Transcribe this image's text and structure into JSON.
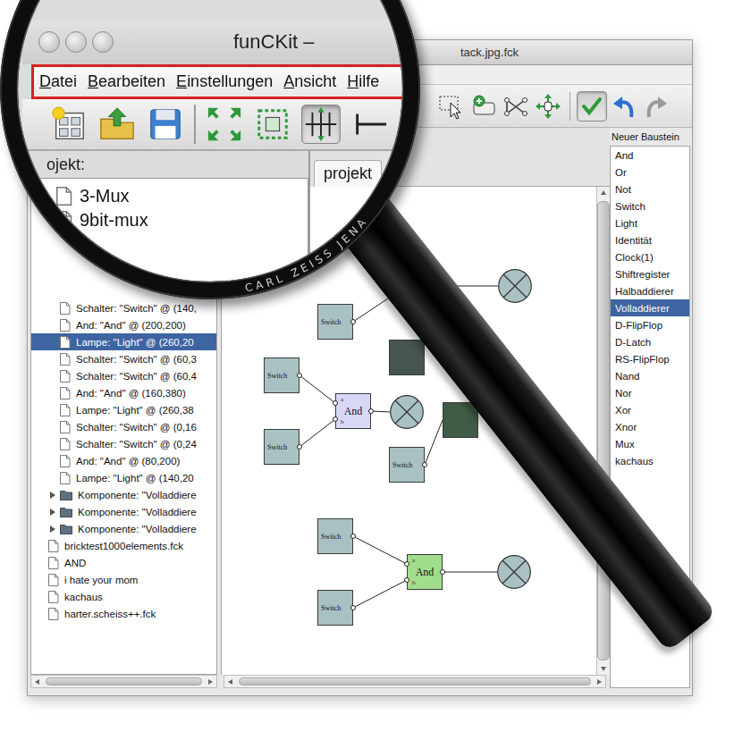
{
  "window": {
    "title": "tack.jpg.fck"
  },
  "toolbar": [
    {
      "kind": "select",
      "selected": false
    },
    {
      "kind": "add",
      "selected": false
    },
    {
      "kind": "connect",
      "selected": false
    },
    {
      "kind": "move",
      "selected": false
    },
    {
      "kind": "separator",
      "selected": false
    },
    {
      "kind": "check",
      "selected": true
    },
    {
      "kind": "undo",
      "selected": false
    },
    {
      "kind": "redo",
      "selected": false
    }
  ],
  "project_tree": {
    "rows": [
      {
        "text": "Schalter: \"Switch\" @ (140,",
        "kind": "file",
        "level": 1,
        "selected": false
      },
      {
        "text": "And: \"And\" @ (200,200)",
        "kind": "file",
        "level": 1,
        "selected": false
      },
      {
        "text": "Lampe: \"Light\" @ (260,20",
        "kind": "file",
        "level": 1,
        "selected": true
      },
      {
        "text": "Schalter: \"Switch\" @ (60,3",
        "kind": "file",
        "level": 1,
        "selected": false
      },
      {
        "text": "Schalter: \"Switch\" @ (60,4",
        "kind": "file",
        "level": 1,
        "selected": false
      },
      {
        "text": "And: \"And\" @ (160,380)",
        "kind": "file",
        "level": 1,
        "selected": false
      },
      {
        "text": "Lampe: \"Light\" @ (260,38",
        "kind": "file",
        "level": 1,
        "selected": false
      },
      {
        "text": "Schalter: \"Switch\" @ (0,16",
        "kind": "file",
        "level": 1,
        "selected": false
      },
      {
        "text": "Schalter: \"Switch\" @ (0,24",
        "kind": "file",
        "level": 1,
        "selected": false
      },
      {
        "text": "And: \"And\" @ (80,200)",
        "kind": "file",
        "level": 1,
        "selected": false
      },
      {
        "text": "Lampe: \"Light\" @ (140,20",
        "kind": "file",
        "level": 1,
        "selected": false
      },
      {
        "text": "Komponente: \"Volladdiere",
        "kind": "folder",
        "level": 1,
        "selected": false,
        "expanded": false
      },
      {
        "text": "Komponente: \"Volladdiere",
        "kind": "folder",
        "level": 1,
        "selected": false,
        "expanded": false
      },
      {
        "text": "Komponente: \"Volladdiere",
        "kind": "folder",
        "level": 1,
        "selected": false,
        "expanded": false
      },
      {
        "text": "bricktest1000elements.fck",
        "kind": "file",
        "level": 0,
        "selected": false
      },
      {
        "text": "AND",
        "kind": "file",
        "level": 0,
        "selected": false
      },
      {
        "text": "i hate your mom",
        "kind": "file",
        "level": 0,
        "selected": false
      },
      {
        "text": "kachaus",
        "kind": "file",
        "level": 0,
        "selected": false
      },
      {
        "text": "harter.scheiss++.fck",
        "kind": "file",
        "level": 0,
        "selected": false
      }
    ]
  },
  "palette": {
    "label": "Neuer Baustein",
    "items": [
      {
        "label": "And",
        "selected": false
      },
      {
        "label": "Or",
        "selected": false
      },
      {
        "label": "Not",
        "selected": false
      },
      {
        "label": "Switch",
        "selected": false
      },
      {
        "label": "Light",
        "selected": false
      },
      {
        "label": "Identität",
        "selected": false
      },
      {
        "label": "Clock(1)",
        "selected": false
      },
      {
        "label": "Shiftregister",
        "selected": false
      },
      {
        "label": "Halbaddierer",
        "selected": false
      },
      {
        "label": "Volladdierer",
        "selected": true
      },
      {
        "label": "D-FlipFlop",
        "selected": false
      },
      {
        "label": "D-Latch",
        "selected": false
      },
      {
        "label": "RS-FlipFlop",
        "selected": false
      },
      {
        "label": "Nand",
        "selected": false
      },
      {
        "label": "Nor",
        "selected": false
      },
      {
        "label": "Xor",
        "selected": false
      },
      {
        "label": "Xnor",
        "selected": false
      },
      {
        "label": "Mux",
        "selected": false
      },
      {
        "label": "kachaus",
        "selected": false
      }
    ]
  },
  "canvas": {
    "components": [
      {
        "kind": "switch",
        "label": "Switch",
        "color": "#a9c1c3"
      },
      {
        "kind": "block",
        "color": "#3d5d4a"
      },
      {
        "kind": "light",
        "color": "#a9c1c3"
      },
      {
        "kind": "switch",
        "label": "Switch",
        "color": "#a9c1c3"
      },
      {
        "kind": "switch",
        "label": "Switch",
        "color": "#a9c1c3"
      },
      {
        "kind": "and",
        "label": "And",
        "ports": [
          "a",
          "b"
        ],
        "color": "#d8d8f6"
      },
      {
        "kind": "light",
        "color": "#a9c1c3"
      },
      {
        "kind": "block",
        "color": "#46554f"
      },
      {
        "kind": "block",
        "color": "#3f5a45"
      },
      {
        "kind": "switch",
        "label": "Switch",
        "color": "#a9c1c3"
      },
      {
        "kind": "switch",
        "label": "Switch",
        "color": "#a9c1c3"
      },
      {
        "kind": "switch",
        "label": "Switch",
        "color": "#a9c1c3"
      },
      {
        "kind": "and",
        "label": "And",
        "ports": [
          "a",
          "b"
        ],
        "color": "#a0dd8c"
      },
      {
        "kind": "light",
        "color": "#a9c1c3"
      }
    ],
    "wires": [
      {
        "from": 0,
        "to": 1,
        "port": 0
      },
      {
        "from": 1,
        "to": 2,
        "port": 0
      },
      {
        "from": 3,
        "to": 5,
        "port": 0
      },
      {
        "from": 4,
        "to": 5,
        "port": 1
      },
      {
        "from": 5,
        "to": 6,
        "port": 0
      },
      {
        "from": 9,
        "to": 8,
        "port": 0
      },
      {
        "from": 10,
        "to": 12,
        "port": 0
      },
      {
        "from": 11,
        "to": 12,
        "port": 1
      },
      {
        "from": 12,
        "to": 13,
        "port": 0
      }
    ]
  },
  "magnifier": {
    "brand": "CARL ZEISS JENA",
    "title": "funCKit –",
    "menu": [
      "Datei",
      "Bearbeiten",
      "Einstellungen",
      "Ansicht",
      "Hilfe"
    ],
    "tools": [
      {
        "kind": "new",
        "selected": false
      },
      {
        "kind": "open",
        "selected": false
      },
      {
        "kind": "save",
        "selected": false
      },
      {
        "kind": "separator",
        "selected": false
      },
      {
        "kind": "fit",
        "selected": false
      },
      {
        "kind": "zoom",
        "selected": false
      },
      {
        "kind": "grid",
        "selected": true
      },
      {
        "kind": "more",
        "selected": false
      }
    ],
    "panel_label": "ojekt:",
    "tab": "projekt",
    "tree": [
      "3-Mux",
      "9bit-mux"
    ]
  }
}
